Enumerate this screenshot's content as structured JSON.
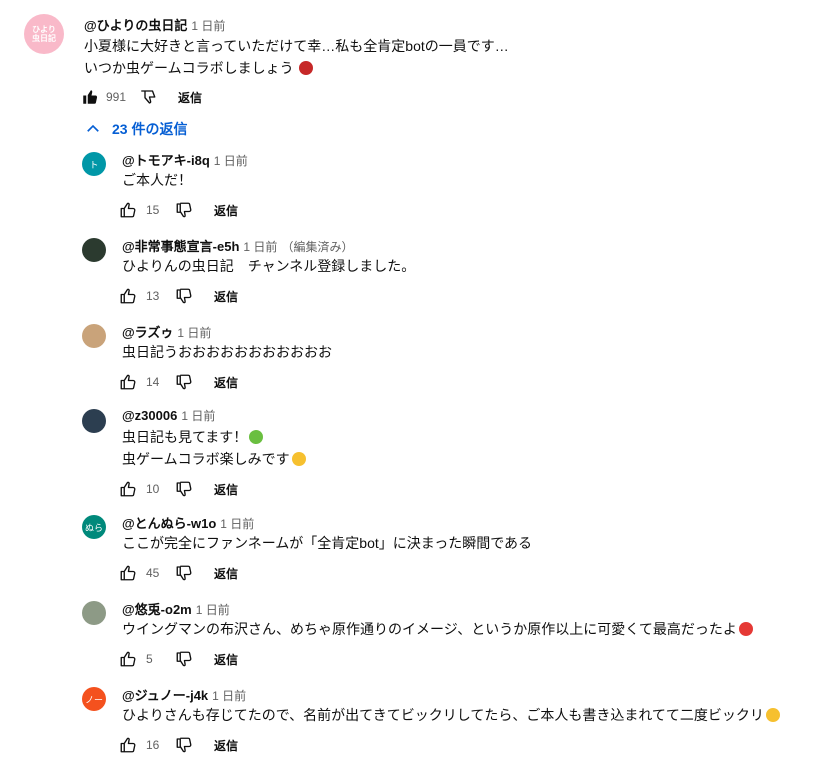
{
  "top_comment": {
    "author": "@ひよりの虫日記",
    "time": "1 日前",
    "lines": [
      "小夏様に大好きと言っていただけて幸…私も全肯定botの一員です…",
      "いつか虫ゲームコラボしましょう"
    ],
    "likes": "991",
    "reply_label": "返信",
    "avatar_text": "ひより虫日記"
  },
  "replies_toggle": {
    "label": "23 件の返信"
  },
  "replies": [
    {
      "author": "@トモアキ-i8q",
      "time": "1 日前",
      "edited": "",
      "lines": [
        "ご本人だ！"
      ],
      "likes": "15",
      "reply_label": "返信",
      "avatar_text": "ト",
      "avatar_color": "#0097a7"
    },
    {
      "author": "@非常事態宣言-e5h",
      "time": "1 日前",
      "edited": "（編集済み）",
      "lines": [
        "ひよりんの虫日記　チャンネル登録しました。"
      ],
      "likes": "13",
      "reply_label": "返信",
      "avatar_text": "",
      "avatar_color": "#2b3a2f"
    },
    {
      "author": "@ラズゥ",
      "time": "1 日前",
      "edited": "",
      "lines": [
        "虫日記うおおおおおおおおおおお"
      ],
      "likes": "14",
      "reply_label": "返信",
      "avatar_text": "",
      "avatar_color": "#c9a37a"
    },
    {
      "author": "@z30006",
      "time": "1 日前",
      "edited": "",
      "lines": [
        "虫日記も見てます！",
        "虫ゲームコラボ楽しみです"
      ],
      "likes": "10",
      "reply_label": "返信",
      "avatar_text": "",
      "avatar_color": "#2c3e50"
    },
    {
      "author": "@とんぬら-w1o",
      "time": "1 日前",
      "edited": "",
      "lines": [
        "ここが完全にファンネームが「全肯定bot」に決まった瞬間である"
      ],
      "likes": "45",
      "reply_label": "返信",
      "avatar_text": "ぬら",
      "avatar_color": "#00897b"
    },
    {
      "author": "@悠兎-o2m",
      "time": "1 日前",
      "edited": "",
      "lines": [
        "ウイングマンの布沢さん、めちゃ原作通りのイメージ、というか原作以上に可愛くて最高だったよ"
      ],
      "likes": "5",
      "reply_label": "返信",
      "avatar_text": "",
      "avatar_color": "#8d9a86"
    },
    {
      "author": "@ジュノー-j4k",
      "time": "1 日前",
      "edited": "",
      "lines": [
        "ひよりさんも存じてたので、名前が出てきてビックリしてたら、ご本人も書き込まれてて二度ビックリ"
      ],
      "likes": "16",
      "reply_label": "返信",
      "avatar_text": "ノー",
      "avatar_color": "#f4511e"
    }
  ]
}
